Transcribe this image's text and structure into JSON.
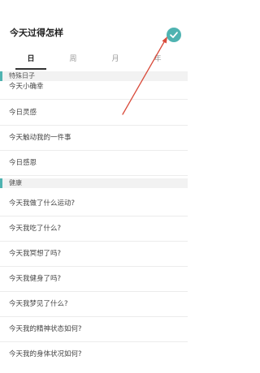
{
  "header": {
    "title": "今天过得怎样",
    "confirm_icon": "checkmark-circle-icon",
    "confirm_color": "#4fb3b1"
  },
  "tabs": [
    {
      "label": "日",
      "active": true
    },
    {
      "label": "周",
      "active": false
    },
    {
      "label": "月",
      "active": false
    },
    {
      "label": "年",
      "active": false
    }
  ],
  "sections": [
    {
      "title": "特殊日子",
      "items": [
        "今天小确幸",
        "今日灵感",
        "今天触动我的一件事",
        "今日感恩"
      ]
    },
    {
      "title": "健康",
      "items": [
        "今天我做了什么运动?",
        "今天我吃了什么?",
        "今天我冥想了吗?",
        "今天我健身了吗?",
        "今天我梦见了什么?",
        "今天我的精神状态如何?",
        "今天我的身体状况如何?"
      ]
    }
  ],
  "colors": {
    "accent": "#4fb3b1",
    "annotation_arrow": "#d94a3a"
  }
}
